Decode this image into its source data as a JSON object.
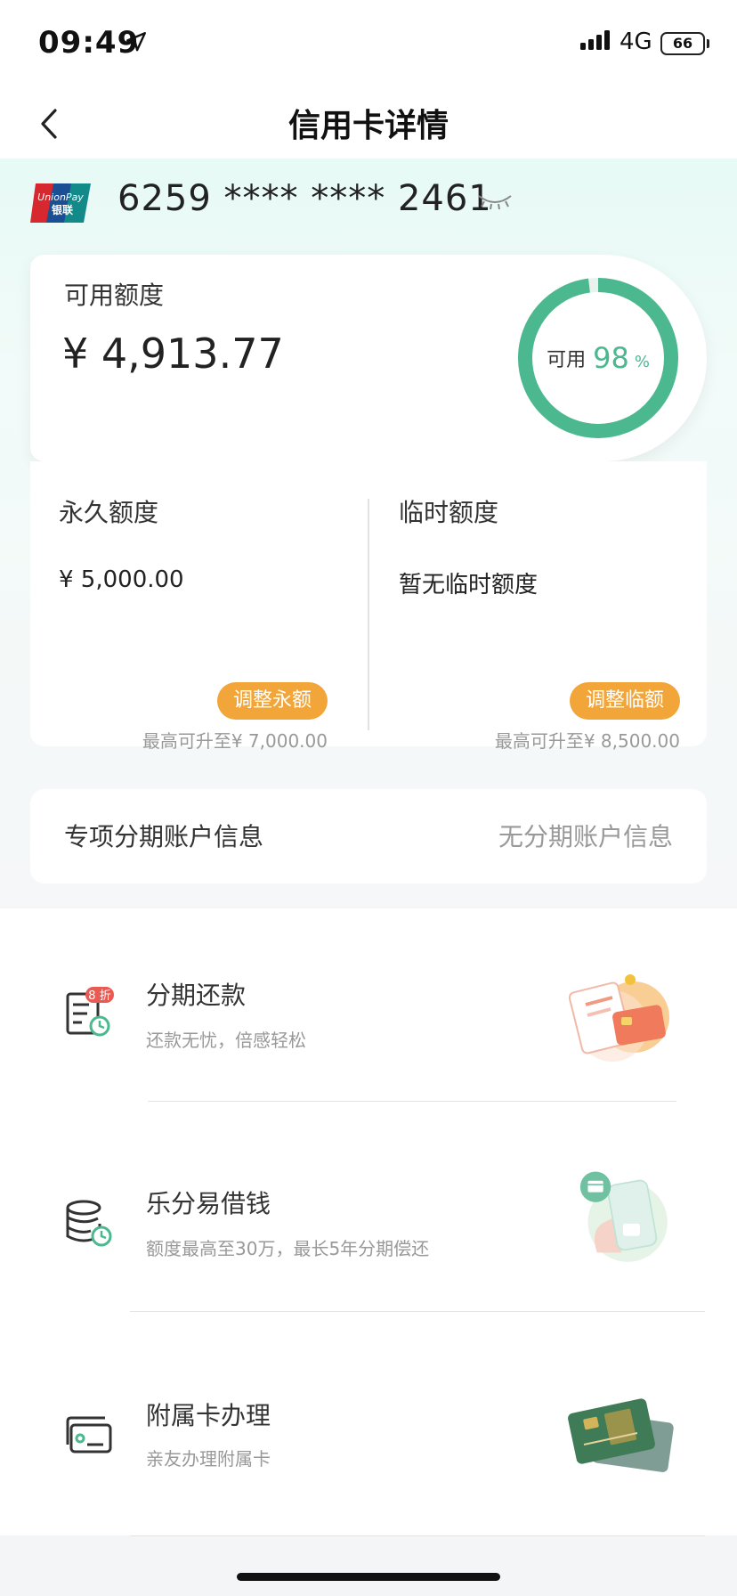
{
  "status": {
    "time": "09:49",
    "network": "4G",
    "battery": "66"
  },
  "nav": {
    "title": "信用卡详情"
  },
  "card": {
    "brand_label": "UnionPay",
    "brand_cn": "银联",
    "number": "6259 **** **** 2461"
  },
  "available": {
    "label": "可用额度",
    "amount": "¥ 4,913.77",
    "ring_label": "可用",
    "percent": "98",
    "percent_unit": "%",
    "fraction": 0.98
  },
  "permanent": {
    "title": "永久额度",
    "value": "¥ 5,000.00",
    "button": "调整永额",
    "note": "最高可升至¥ 7,000.00"
  },
  "temporary": {
    "title": "临时额度",
    "value": "暂无临时额度",
    "button": "调整临额",
    "note": "最高可升至¥ 8,500.00"
  },
  "installment_account": {
    "label": "专项分期账户信息",
    "value": "无分期账户信息"
  },
  "services": [
    {
      "name": "分期还款",
      "sub": "还款无忧，倍感轻松",
      "badge": "8 折",
      "icon": "bill-clock-icon"
    },
    {
      "name": "乐分易借钱",
      "sub": "额度最高至30万，最长5年分期偿还",
      "icon": "coins-clock-icon"
    },
    {
      "name": "附属卡办理",
      "sub": "亲友办理附属卡",
      "icon": "card-icon"
    }
  ],
  "colors": {
    "accent_green": "#4bb88f",
    "button_orange": "#f2a63a"
  }
}
